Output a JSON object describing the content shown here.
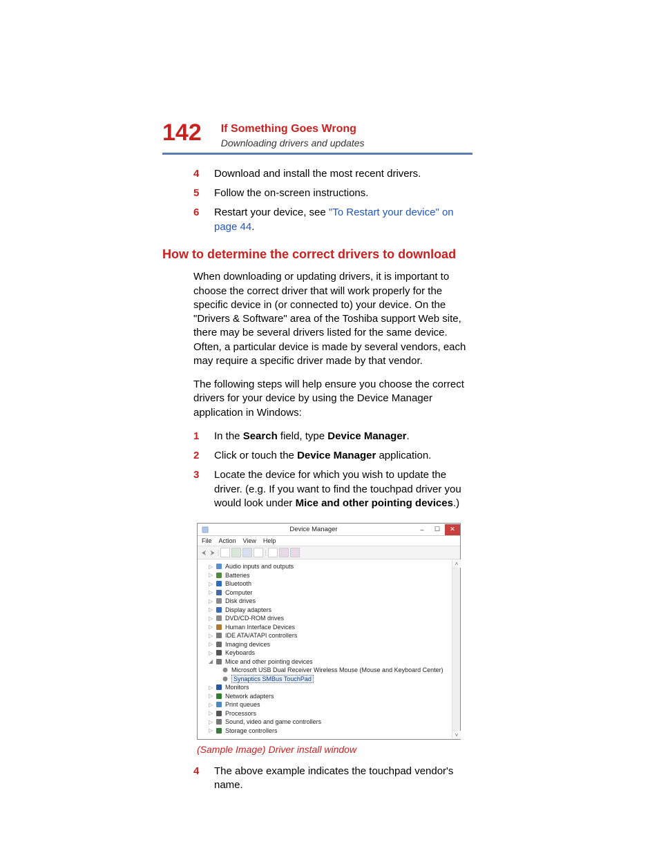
{
  "page_number": "142",
  "chapter_title": "If Something Goes Wrong",
  "section_subtitle": "Downloading drivers and updates",
  "top_list": [
    {
      "n": "4",
      "text": "Download and install the most recent drivers."
    },
    {
      "n": "5",
      "text": "Follow the on-screen instructions."
    },
    {
      "n": "6",
      "prefix": "Restart your device, see ",
      "link": "\"To Restart your device\" on page 44",
      "suffix": "."
    }
  ],
  "h2": "How to determine the correct drivers to download",
  "para1": "When downloading or updating drivers, it is important to choose the correct driver that will work properly for the specific device in (or connected to) your device. On the \"Drivers & Software\" area of the Toshiba support Web site, there may be several drivers listed for the same device. Often, a particular device is made by several vendors, each may require a specific driver made by that vendor.",
  "para2": "The following steps will help ensure you choose the correct drivers for your device by using the Device Manager application in Windows:",
  "mid_list": [
    {
      "n": "1",
      "segs": [
        {
          "t": "In the "
        },
        {
          "t": "Search",
          "b": true
        },
        {
          "t": " field, type "
        },
        {
          "t": "Device Manager",
          "b": true
        },
        {
          "t": "."
        }
      ]
    },
    {
      "n": "2",
      "segs": [
        {
          "t": "Click or touch the "
        },
        {
          "t": "Device Manager",
          "b": true
        },
        {
          "t": " application."
        }
      ]
    },
    {
      "n": "3",
      "segs": [
        {
          "t": "Locate the device for which you wish to update the driver. (e.g. If you want to find the touchpad driver you would look under "
        },
        {
          "t": "Mice and other pointing devices",
          "b": true
        },
        {
          "t": ".)"
        }
      ]
    }
  ],
  "dm": {
    "title": "Device Manager",
    "menus": [
      "File",
      "Action",
      "View",
      "Help"
    ],
    "tree": [
      {
        "label": "Audio inputs and outputs",
        "icon": "#5a8fcf"
      },
      {
        "label": "Batteries",
        "icon": "#4e8a3b"
      },
      {
        "label": "Bluetooth",
        "icon": "#2a6cc2"
      },
      {
        "label": "Computer",
        "icon": "#4a6aa6"
      },
      {
        "label": "Disk drives",
        "icon": "#8a8a8a"
      },
      {
        "label": "Display adapters",
        "icon": "#3a6ac0"
      },
      {
        "label": "DVD/CD-ROM drives",
        "icon": "#8a8a8a"
      },
      {
        "label": "Human Interface Devices",
        "icon": "#b07830"
      },
      {
        "label": "IDE ATA/ATAPI controllers",
        "icon": "#7a7a7a"
      },
      {
        "label": "Imaging devices",
        "icon": "#6a6a6a"
      },
      {
        "label": "Keyboards",
        "icon": "#555"
      },
      {
        "label": "Mice and other pointing devices",
        "icon": "#777",
        "expanded": true,
        "children": [
          {
            "label": "Microsoft USB Dual Receiver Wireless Mouse (Mouse and Keyboard Center)"
          },
          {
            "label": "Synaptics SMBus TouchPad",
            "selected": true
          }
        ]
      },
      {
        "label": "Monitors",
        "icon": "#2458a8"
      },
      {
        "label": "Network adapters",
        "icon": "#2e7e2e"
      },
      {
        "label": "Print queues",
        "icon": "#4a8ac0"
      },
      {
        "label": "Processors",
        "icon": "#555"
      },
      {
        "label": "Sound, video and game controllers",
        "icon": "#777"
      },
      {
        "label": "Storage controllers",
        "icon": "#3a7a3a"
      }
    ]
  },
  "caption": "(Sample Image) Driver install window",
  "bottom_list": [
    {
      "n": "4",
      "text": "The above example indicates the touchpad vendor's name."
    }
  ]
}
